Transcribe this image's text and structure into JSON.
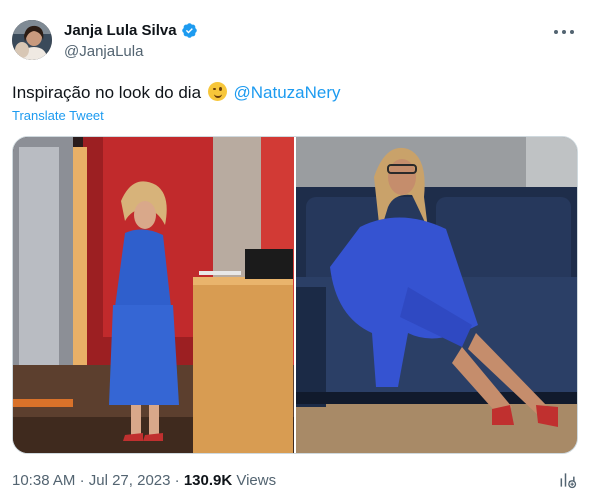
{
  "author": {
    "name": "Janja Lula Silva",
    "handle": "@JanjaLula",
    "verified": true,
    "avatar_icon": "avatar-photo"
  },
  "tweet": {
    "text_before": "Inspiração no look do dia",
    "emoji": "winking-face-emoji",
    "mention": "@NatuzaNery",
    "translate_label": "Translate Tweet"
  },
  "media": [
    {
      "name": "photo-tv-presenter",
      "description_icon": "photo"
    },
    {
      "name": "photo-woman-on-sofa",
      "description_icon": "photo"
    }
  ],
  "meta": {
    "time": "10:38 AM",
    "separator": "·",
    "date": "Jul 27, 2023",
    "views_count": "130.9K",
    "views_label": "Views"
  },
  "colors": {
    "accent": "#1d9bf0",
    "text": "#0f1419",
    "muted": "#536471",
    "border": "#cfd9de"
  },
  "icons": [
    "verified-badge-icon",
    "more-options-icon",
    "analytics-icon"
  ]
}
